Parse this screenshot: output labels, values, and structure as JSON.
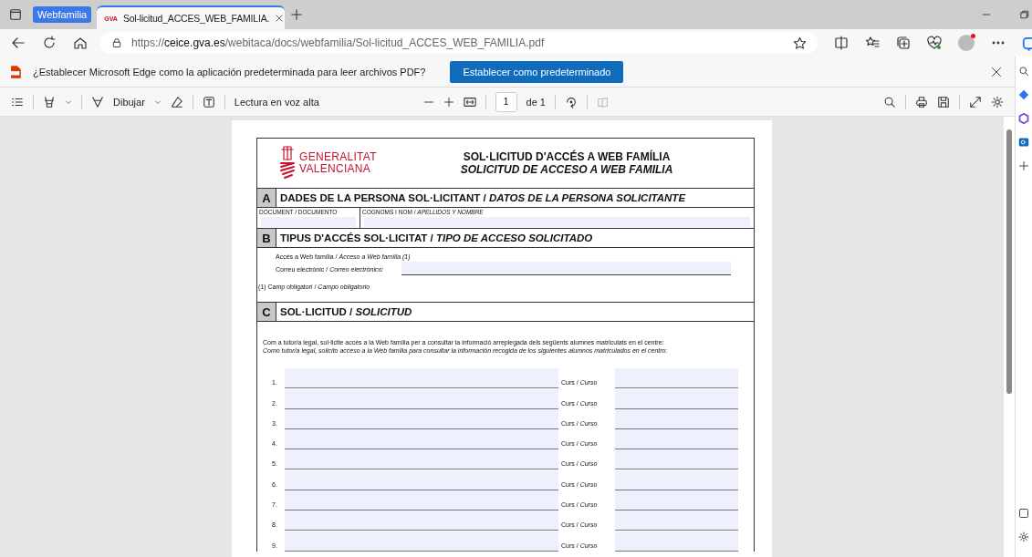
{
  "browser": {
    "tab_group": "Webfamilia",
    "tabs": [
      {
        "favicon": "GVA",
        "title": "Sol-licitud_ACCES_WEB_FAMILIA.",
        "selected": true
      }
    ],
    "url": "https://**ceice.gva.es**/webitaca/docs/webfamilia/Sol-licitud_ACCES_WEB_FAMILIA.pdf"
  },
  "notification": {
    "message": "¿Establecer Microsoft Edge como la aplicación predeterminada para leer archivos PDF?",
    "button": "Establecer como predeterminado"
  },
  "pdf_toolbar": {
    "draw_label": "Dibujar",
    "read_aloud": "Lectura en voz alta",
    "page": "1",
    "page_total": "de 1"
  },
  "document": {
    "logo": [
      "GENERALITAT",
      "VALENCIANA"
    ],
    "title": "SOL·LICITUD D'ACCÉS A  WEB FAMÍLIA",
    "title_translation": "SOLICITUD DE ACCESO A WEB FAMILIA",
    "sections": [
      {
        "letter": "A",
        "kind": "fields",
        "heading": "DADES DE LA PERSONA SOL·LICITANT / *DATOS DE LA PERSONA SOLICITANTE*",
        "fields": [
          {
            "label": "DOCUMENT / DOCUMENTO"
          },
          {
            "label": "COGNOMS I NOM / *APELLIDOS Y NOMBRE*"
          }
        ]
      },
      {
        "letter": "B",
        "kind": "access",
        "heading": "TIPUS D'ACCÉS SOL·LICITAT / *TIPO DE ACCESO SOLICITADO*",
        "access_label": "Accés a Web família / *Acceso a Web família (1)*",
        "email_label": "Correu electrònic / *Correo electrónico:*",
        "note": "(1) Camp obligatori / *Campo obligatorio*"
      },
      {
        "letter": "C",
        "kind": "request",
        "heading": "SOL·LICITUD / *SOLICITUD*",
        "intro": "Com a tutor/a legal, sol·licite accés a la Web família per a consultar la informació arreplegada dels següents alumnes matriculats en el centre:",
        "intro_translation": "Como tutor/a legal, solicito acceso a la Web familia para consultar la información recogida de los siguientes alumnos matriculados en el centro:",
        "students": [
          {
            "number": "1.",
            "course_label": "Curs / *Curso*"
          },
          {
            "number": "2.",
            "course_label": "Curs / *Curso*"
          },
          {
            "number": "3.",
            "course_label": "Curs / *Curso*"
          },
          {
            "number": "4.",
            "course_label": "Curs / *Curso*"
          },
          {
            "number": "5.",
            "course_label": "Curs / *Curso*"
          },
          {
            "number": "6.",
            "course_label": "Curs / *Curso*"
          },
          {
            "number": "7.",
            "course_label": "Curs / *Curso*"
          },
          {
            "number": "8.",
            "course_label": "Curs / *Curso*"
          },
          {
            "number": "9.",
            "course_label": "Curs / *Curso*"
          }
        ]
      }
    ]
  }
}
